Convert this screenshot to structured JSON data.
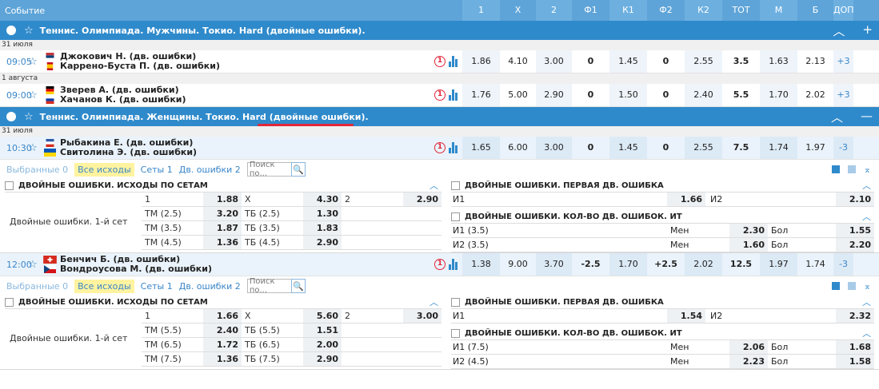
{
  "header": {
    "event": "Событие",
    "cols": [
      "1",
      "X",
      "2",
      "Ф1",
      "К1",
      "Ф2",
      "К2",
      "ТОТ",
      "М",
      "Б",
      "ДОП"
    ]
  },
  "league1": {
    "title": "Теннис. Олимпиада. Мужчины. Токио. Hard (двойные ошибки)."
  },
  "league2": {
    "title_a": "Теннис. Олимпиада. Женщины. Токио. Hard ",
    "title_b": "(двойные ошибки)."
  },
  "dates": [
    "31 июля",
    "1 августа",
    "31 июля"
  ],
  "matches": [
    {
      "time": "09:05",
      "p1": "Джокович Н. (дв. ошибки)",
      "p2": "Каррено-Буста П. (дв. ошибки)",
      "odds": [
        "1.86",
        "4.10",
        "3.00",
        "0",
        "1.45",
        "0",
        "2.55",
        "3.5",
        "1.63",
        "2.13",
        "+3"
      ]
    },
    {
      "time": "09:00",
      "p1": "Зверев А. (дв. ошибки)",
      "p2": "Хачанов К. (дв. ошибки)",
      "odds": [
        "1.76",
        "5.00",
        "2.90",
        "0",
        "1.50",
        "0",
        "2.40",
        "5.5",
        "1.70",
        "2.02",
        "+3"
      ]
    },
    {
      "time": "10:30",
      "p1": "Рыбакина Е. (дв. ошибки)",
      "p2": "Свитолина Э. (дв. ошибки)",
      "odds": [
        "1.65",
        "6.00",
        "3.00",
        "0",
        "1.45",
        "0",
        "2.55",
        "7.5",
        "1.74",
        "1.97",
        "-3"
      ]
    },
    {
      "time": "12:00",
      "p1": "Бенчич Б. (дв. ошибки)",
      "p2": "Вондроусова М. (дв. ошибки)",
      "odds": [
        "1.38",
        "9.00",
        "3.70",
        "-2.5",
        "1.70",
        "+2.5",
        "2.02",
        "12.5",
        "1.97",
        "1.74",
        "-3"
      ]
    }
  ],
  "icons": {
    "circle_label": "1"
  },
  "tabs": {
    "selected": "Выбранные 0",
    "all": "Все исходы",
    "sets": "Сеты 1",
    "df": "Дв. ошибки 2",
    "search_placeholder": "Поиск по..."
  },
  "panel": {
    "sets_title": "ДВОЙНЫЕ ОШИБКИ. ИСХОДЫ ПО СЕТАМ",
    "row_label": "Двойные ошибки. 1-й сет",
    "first_title": "ДВОЙНЫЕ ОШИБКИ. ПЕРВАЯ ДВ. ОШИБКА",
    "count_title": "ДВОЙНЫЕ ОШИБКИ. КОЛ-ВО ДВ. ОШИБОК. ИТ",
    "i1": "И1",
    "i2": "И2",
    "men": "Мен",
    "bol": "Бол",
    "x": "Х",
    "two": "2",
    "one": "1"
  },
  "p1": {
    "sets": {
      "v1": "1.88",
      "vx": "4.30",
      "v2": "2.90",
      "tot": [
        {
          "tm": "ТМ (2.5)",
          "tmv": "3.20",
          "tb": "ТБ (2.5)",
          "tbv": "1.30"
        },
        {
          "tm": "ТМ (3.5)",
          "tmv": "1.87",
          "tb": "ТБ (3.5)",
          "tbv": "1.83"
        },
        {
          "tm": "ТМ (4.5)",
          "tmv": "1.36",
          "tb": "ТБ (4.5)",
          "tbv": "2.90"
        }
      ]
    },
    "first": {
      "i1": "1.66",
      "i2": "2.10"
    },
    "count": [
      {
        "l": "И1 (3.5)",
        "m": "2.30",
        "b": "1.55"
      },
      {
        "l": "И2 (3.5)",
        "m": "1.60",
        "b": "2.20"
      }
    ]
  },
  "p2": {
    "sets": {
      "v1": "1.66",
      "vx": "5.60",
      "v2": "3.00",
      "tot": [
        {
          "tm": "ТМ (5.5)",
          "tmv": "2.40",
          "tb": "ТБ (5.5)",
          "tbv": "1.51"
        },
        {
          "tm": "ТМ (6.5)",
          "tmv": "1.72",
          "tb": "ТБ (6.5)",
          "tbv": "2.00"
        },
        {
          "tm": "ТМ (7.5)",
          "tmv": "1.36",
          "tb": "ТБ (7.5)",
          "tbv": "2.90"
        }
      ]
    },
    "first": {
      "i1": "1.54",
      "i2": "2.32"
    },
    "count": [
      {
        "l": "И1 (7.5)",
        "m": "2.06",
        "b": "1.68"
      },
      {
        "l": "И2 (4.5)",
        "m": "2.23",
        "b": "1.58"
      }
    ]
  }
}
